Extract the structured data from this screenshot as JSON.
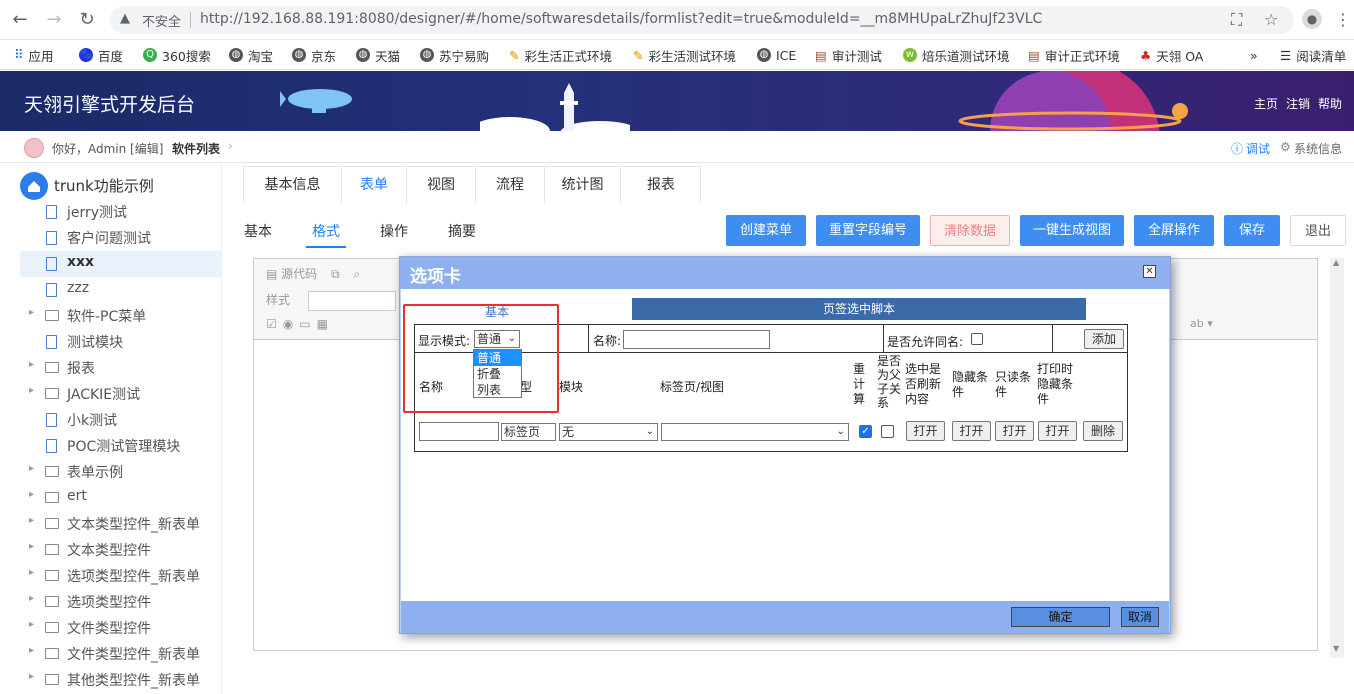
{
  "browser": {
    "not_secure": "不安全",
    "url": "http://192.168.88.191:8080/designer/#/home/softwaresdetails/formlist?edit=true&moduleId=__m8MHUpaLrZhuJf23VLC",
    "reading_list": "阅读清单",
    "more": "»",
    "bookmarks": [
      "应用",
      "百度",
      "360搜索",
      "淘宝",
      "京东",
      "天猫",
      "苏宁易购",
      "彩生活正式环境",
      "彩生活测试环境",
      "ICE",
      "审计测试",
      "焙乐道测试环境",
      "审计正式环境",
      "天翎 OA"
    ]
  },
  "header": {
    "title": "天翎引擎式开发后台",
    "links": [
      "主页",
      "注销",
      "帮助"
    ]
  },
  "subheader": {
    "greeting": "你好，Admin [编辑]",
    "crumb": "软件列表",
    "debug": "调试",
    "sysinfo": "系统信息"
  },
  "sidebar": {
    "root": "trunk功能示例",
    "items": [
      {
        "label": "jerry测试",
        "type": "file"
      },
      {
        "label": "客户问题测试",
        "type": "file"
      },
      {
        "label": "xxx",
        "type": "file",
        "active": true
      },
      {
        "label": "zzz",
        "type": "file"
      },
      {
        "label": "软件-PC菜单",
        "type": "folder"
      },
      {
        "label": "测试模块",
        "type": "file"
      },
      {
        "label": "报表",
        "type": "folder"
      },
      {
        "label": "JACKIE测试",
        "type": "folder"
      },
      {
        "label": "小k测试",
        "type": "file"
      },
      {
        "label": "POC测试管理模块",
        "type": "file"
      },
      {
        "label": "表单示例",
        "type": "folder"
      },
      {
        "label": "ert",
        "type": "folder"
      },
      {
        "label": "文本类型控件_新表单",
        "type": "folder"
      },
      {
        "label": "文本类型控件",
        "type": "folder"
      },
      {
        "label": "选项类型控件_新表单",
        "type": "folder"
      },
      {
        "label": "选项类型控件",
        "type": "folder"
      },
      {
        "label": "文件类型控件",
        "type": "folder"
      },
      {
        "label": "文件类型控件_新表单",
        "type": "folder"
      },
      {
        "label": "其他类型控件_新表单",
        "type": "folder"
      }
    ]
  },
  "main": {
    "tabs": [
      "基本信息",
      "表单",
      "视图",
      "流程",
      "统计图",
      "报表"
    ],
    "subtabs": [
      "基本",
      "格式",
      "操作",
      "摘要"
    ],
    "buttons": [
      "创建菜单",
      "重置字段编号",
      "清除数据",
      "一键生成视图",
      "全屏操作",
      "保存",
      "退出"
    ],
    "toolbar": {
      "source": "源代码",
      "style": "样式"
    }
  },
  "dialog": {
    "title": "选项卡",
    "tab_basic": "基本",
    "tab_script": "页签选中脚本",
    "display_mode_label": "显示模式:",
    "display_mode_value": "普通",
    "display_mode_options": [
      "普通",
      "折叠",
      "列表"
    ],
    "name_label": "名称:",
    "allow_same_name": "是否允许同名:",
    "add": "添加",
    "cols": {
      "name": "名称",
      "type": "型",
      "module": "模块",
      "tabview": "标签页/视图",
      "recalc": "重计算",
      "parent_child": "是否为父子关系",
      "refresh": "选中是否刷新内容",
      "hide_cond": "隐藏条件",
      "readonly_cond": "只读条件",
      "print_hide": "打印时隐藏条件"
    },
    "row": {
      "type_value": "标签页",
      "module_value": "无",
      "open": "打开",
      "delete": "删除"
    },
    "ok": "确定",
    "cancel": "取消"
  }
}
